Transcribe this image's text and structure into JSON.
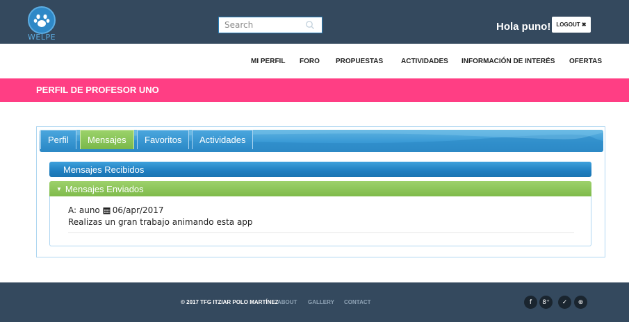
{
  "header": {
    "logo_text": "WELPE",
    "search_placeholder": "Search",
    "greeting": "Hola puno!",
    "logout_label": "LOGOUT ✖"
  },
  "nav": {
    "items": [
      {
        "label": "MI PERFIL"
      },
      {
        "label": "FORO"
      },
      {
        "label": "PROPUESTAS"
      },
      {
        "label": "ACTIVIDADES"
      },
      {
        "label": "INFORMACIÓN DE INTERÉS"
      },
      {
        "label": "OFERTAS"
      }
    ]
  },
  "banner": {
    "title": "PERFIL DE PROFESOR UNO"
  },
  "tabs": {
    "items": [
      {
        "label": "Perfil"
      },
      {
        "label": "Mensajes"
      },
      {
        "label": "Favoritos"
      },
      {
        "label": "Actividades"
      }
    ],
    "active": "Mensajes"
  },
  "messages": {
    "received_header": "Mensajes Recibidos",
    "sent_header": "Mensajes Enviados",
    "sent": [
      {
        "recipient_label": "A: auno",
        "date": "06/apr/2017",
        "text": "Realizas un gran trabajo animando esta app"
      }
    ]
  },
  "footer": {
    "copyright": "© 2017 TFG ITZIAR POLO MARTÍNEZ",
    "links": [
      {
        "label": "ABOUT"
      },
      {
        "label": "GALLERY"
      },
      {
        "label": "CONTACT"
      }
    ],
    "social": [
      {
        "icon": "facebook-icon",
        "glyph": "f"
      },
      {
        "icon": "google-plus-icon",
        "glyph": "8⁺"
      },
      {
        "icon": "twitter-icon",
        "glyph": "✓"
      },
      {
        "icon": "dribbble-icon",
        "glyph": "⊛"
      }
    ]
  },
  "colors": {
    "header_bg": "#34495e",
    "banner_bg": "#ff3e84",
    "tab_active": "#7ab84a",
    "accent_blue": "#2c8ac8"
  }
}
